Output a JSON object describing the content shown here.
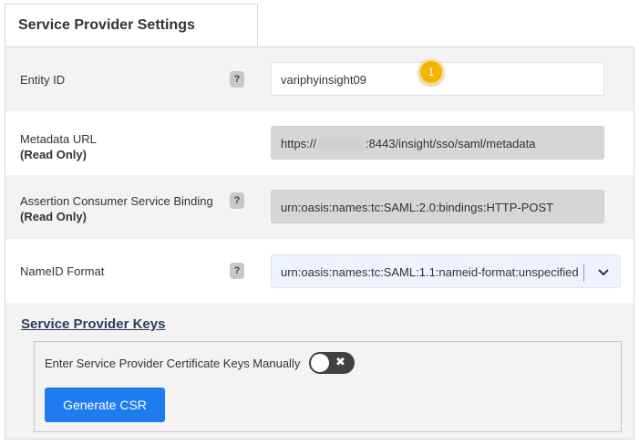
{
  "tab": {
    "title": "Service Provider Settings"
  },
  "fields": {
    "entity_id": {
      "label": "Entity ID",
      "value": "variphyinsight09"
    },
    "metadata_url": {
      "label": "Metadata URL",
      "sublabel": "(Read Only)",
      "value_prefix": "https://",
      "value_suffix": ":8443/insight/sso/saml/metadata"
    },
    "acs_binding": {
      "label": "Assertion Consumer Service Binding",
      "sublabel": "(Read Only)",
      "value": "urn:oasis:names:tc:SAML:2.0:bindings:HTTP-POST"
    },
    "nameid_format": {
      "label": "NameID Format",
      "value": "urn:oasis:names:tc:SAML:1.1:nameid-format:unspecified"
    }
  },
  "help_icon_text": "?",
  "callout_badge": "1",
  "keys": {
    "title": "Service Provider Keys",
    "manual_label": "Enter Service Provider Certificate Keys Manually",
    "toggle_on": false,
    "toggle_glyph": "✖",
    "generate_button": "Generate CSR"
  },
  "colors": {
    "accent": "#1e7cf0",
    "badge": "#f5b400",
    "panel_bg": "#f3f3f3",
    "readonly_bg": "#d6d6d6",
    "select_bg": "#eef4ff"
  },
  "icons": {
    "help": "question-mark-icon",
    "dropdown": "chevron-down-icon",
    "toggle": "close-icon"
  }
}
